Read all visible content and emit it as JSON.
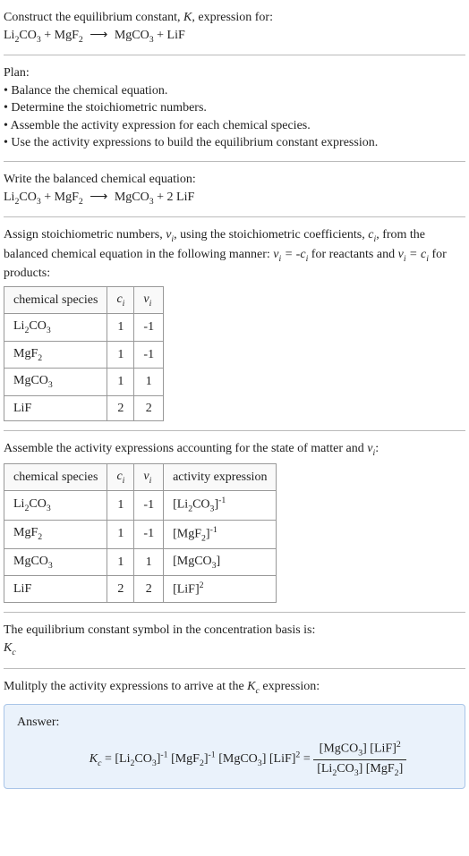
{
  "intro": {
    "line1": "Construct the equilibrium constant, ",
    "K": "K",
    "line1b": ", expression for:",
    "equation": "Li₂CO₃ + MgF₂  ⟶  MgCO₃ + LiF"
  },
  "plan": {
    "header": "Plan:",
    "items": [
      "• Balance the chemical equation.",
      "• Determine the stoichiometric numbers.",
      "• Assemble the activity expression for each chemical species.",
      "• Use the activity expressions to build the equilibrium constant expression."
    ]
  },
  "balanced": {
    "header": "Write the balanced chemical equation:",
    "equation": "Li₂CO₃ + MgF₂  ⟶  MgCO₃ + 2 LiF"
  },
  "assign": {
    "text1": "Assign stoichiometric numbers, ",
    "nu": "νᵢ",
    "text2": ", using the stoichiometric coefficients, ",
    "ci": "cᵢ",
    "text3": ", from the balanced chemical equation in the following manner: ",
    "eq1": "νᵢ = -cᵢ",
    "text4": " for reactants and ",
    "eq2": "νᵢ = cᵢ",
    "text5": " for products:"
  },
  "table1": {
    "headers": [
      "chemical species",
      "cᵢ",
      "νᵢ"
    ],
    "rows": [
      [
        "Li₂CO₃",
        "1",
        "-1"
      ],
      [
        "MgF₂",
        "1",
        "-1"
      ],
      [
        "MgCO₃",
        "1",
        "1"
      ],
      [
        "LiF",
        "2",
        "2"
      ]
    ]
  },
  "assemble": {
    "text1": "Assemble the activity expressions accounting for the state of matter and ",
    "nu": "νᵢ",
    "text2": ":"
  },
  "table2": {
    "headers": [
      "chemical species",
      "cᵢ",
      "νᵢ",
      "activity expression"
    ],
    "rows": [
      {
        "sp": "Li₂CO₃",
        "c": "1",
        "n": "-1",
        "a": "[Li₂CO₃]⁻¹"
      },
      {
        "sp": "MgF₂",
        "c": "1",
        "n": "-1",
        "a": "[MgF₂]⁻¹"
      },
      {
        "sp": "MgCO₃",
        "c": "1",
        "n": "1",
        "a": "[MgCO₃]"
      },
      {
        "sp": "LiF",
        "c": "2",
        "n": "2",
        "a": "[LiF]²"
      }
    ]
  },
  "symbol": {
    "text": "The equilibrium constant symbol in the concentration basis is:",
    "kc": "K_c"
  },
  "multiply": {
    "text1": "Mulitply the activity expressions to arrive at the ",
    "kc": "K_c",
    "text2": " expression:"
  },
  "answer": {
    "label": "Answer:",
    "lhs": "K_c = [Li₂CO₃]⁻¹ [MgF₂]⁻¹ [MgCO₃] [LiF]² = ",
    "num": "[MgCO₃] [LiF]²",
    "den": "[Li₂CO₃] [MgF₂]"
  }
}
